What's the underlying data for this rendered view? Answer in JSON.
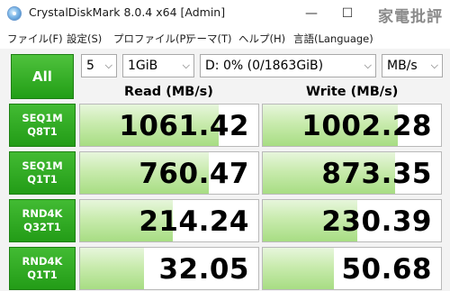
{
  "window": {
    "title": "CrystalDiskMark 8.0.4 x64 [Admin]",
    "min_symbol": "—",
    "max_symbol": "☐",
    "watermark": "家電批評"
  },
  "menu": {
    "items": [
      "ファイル(F)",
      "設定(S)",
      "プロファイル(P)",
      "テーマ(T)",
      "ヘルプ(H)",
      "言語(Language)"
    ]
  },
  "controls": {
    "all_label": "All",
    "count": "5",
    "size": "1GiB",
    "drive": "D: 0% (0/1863GiB)",
    "unit": "MB/s"
  },
  "headers": {
    "read": "Read (MB/s)",
    "write": "Write (MB/s)"
  },
  "rows": [
    {
      "line1": "SEQ1M",
      "line2": "Q8T1",
      "read": "1061.42",
      "write": "1002.28",
      "read_fill": 0.78,
      "write_fill": 0.76
    },
    {
      "line1": "SEQ1M",
      "line2": "Q1T1",
      "read": "760.47",
      "write": "873.35",
      "read_fill": 0.72,
      "write_fill": 0.74
    },
    {
      "line1": "RND4K",
      "line2": "Q32T1",
      "read": "214.24",
      "write": "230.39",
      "read_fill": 0.52,
      "write_fill": 0.53
    },
    {
      "line1": "RND4K",
      "line2": "Q1T1",
      "read": "32.05",
      "write": "50.68",
      "read_fill": 0.36,
      "write_fill": 0.4
    }
  ],
  "colors": {
    "button_green": "#2aa81d",
    "bar_green": "#a7dd83"
  }
}
